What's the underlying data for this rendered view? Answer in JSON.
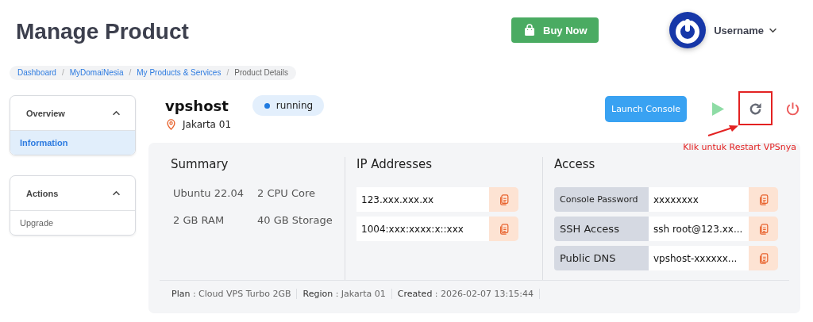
{
  "header": {
    "title": "Manage Product",
    "buy_button": "Buy Now",
    "user": {
      "name": "Username"
    }
  },
  "breadcrumb_separator": "/",
  "breadcrumb": [
    {
      "label": "Dashboard",
      "link": true
    },
    {
      "label": "MyDomaiNesia",
      "link": true
    },
    {
      "label": "My Products & Services",
      "link": true
    },
    {
      "label": "Product Details",
      "link": false
    }
  ],
  "sidebar": [
    {
      "title": "Overview",
      "expanded": true,
      "items": [
        {
          "label": "Information",
          "selected": true
        }
      ]
    },
    {
      "title": "Actions",
      "expanded": true,
      "items": [
        {
          "label": "Upgrade",
          "selected": false
        }
      ]
    }
  ],
  "server": {
    "name": "vpshost",
    "status": "running",
    "location": "Jakarta 01",
    "launch_button": "Launch Console"
  },
  "annotation": {
    "text": "Klik untuk Restart VPSnya"
  },
  "summary": {
    "title": "Summary",
    "specs": [
      "Ubuntu 22.04",
      "2 CPU Core",
      "2 GB RAM",
      "40 GB Storage"
    ]
  },
  "ip_addresses": {
    "title": "IP Addresses",
    "items": [
      "123.xxx.xxx.xx",
      "1004:xxx:xxxx:x::xxx"
    ]
  },
  "access": {
    "title": "Access",
    "items": [
      {
        "label": "Console Password",
        "value": "xxxxxxxx"
      },
      {
        "label": "SSH Access",
        "value": "ssh root@123.xx..."
      },
      {
        "label": "Public DNS",
        "value": "vpshost-xxxxxx..."
      }
    ]
  },
  "footer": [
    "**Plan** : Cloud VPS Turbo 2GB",
    "**Region** : Jakarta 01",
    "**Created** : 2026-02-07 13:15:44"
  ]
}
